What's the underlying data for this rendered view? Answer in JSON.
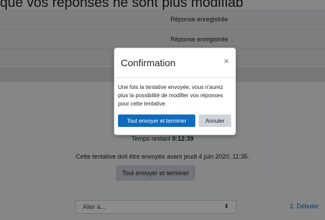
{
  "page": {
    "top_text": "que vos réponses ne sont plus modifiab",
    "rows": [
      {
        "status": "Réponse enregistrée"
      },
      {
        "status": "Réponse enregistrée"
      }
    ],
    "time_label": "Temps restant",
    "time_value": "0:12:39",
    "deadline_text": "Cette tentative doit être envoyée avant jeudi 4 juin 2020, 11:35.",
    "submit_all_label": "Tout envoyer et terminer",
    "goto_select_value": "Aller à...",
    "next_link": "2. Débuter"
  },
  "modal": {
    "title": "Confirmation",
    "close_glyph": "×",
    "body": "Une fois la tentative envoyée, vous n'aurez plus la possibilité de modifier vos réponses pour cette tentative.",
    "confirm_label": "Tout envoyer et terminer",
    "cancel_label": "Annuler"
  }
}
